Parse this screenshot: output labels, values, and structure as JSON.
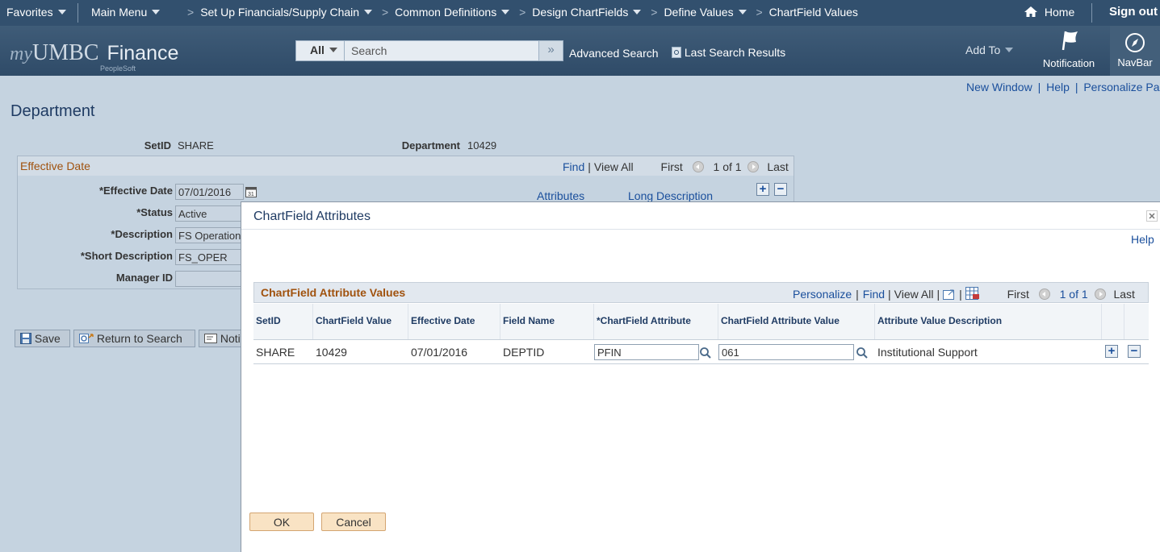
{
  "topbar": {
    "favorites": "Favorites",
    "main_menu": "Main Menu",
    "breadcrumbs": [
      "Set Up Financials/Supply Chain",
      "Common Definitions",
      "Design ChartFields",
      "Define Values",
      "ChartField Values"
    ],
    "home": "Home",
    "sign_out": "Sign out"
  },
  "header": {
    "logo_my": "my",
    "logo_umbc": "UMBC",
    "logo_finance": "Finance",
    "logo_ps": "PeopleSoft",
    "search_scope": "All",
    "search_placeholder": "Search",
    "advanced_search": "Advanced Search",
    "last_search_results": "Last Search Results",
    "add_to": "Add To",
    "notification": "Notification",
    "navbar": "NavBar"
  },
  "page": {
    "links": {
      "new_window": "New Window",
      "help": "Help",
      "personalize_page": "Personalize Page"
    },
    "title": "Department",
    "setid_label": "SetID",
    "setid_value": "SHARE",
    "department_label": "Department",
    "department_value": "10429",
    "effdt_section": "Effective Date",
    "find": "Find",
    "view_all": "View All",
    "first": "First",
    "count": "1 of 1",
    "last": "Last",
    "attributes_link": "Attributes",
    "long_desc_link": "Long Description",
    "fields": {
      "effective_date_label": "*Effective Date",
      "effective_date_value": "07/01/2016",
      "status_label": "*Status",
      "status_value": "Active",
      "description_label": "*Description",
      "description_value": "FS Operation",
      "short_desc_label": "*Short Description",
      "short_desc_value": "FS_OPER",
      "manager_label": "Manager ID",
      "manager_value": ""
    },
    "buttons": {
      "save": "Save",
      "return_to_search": "Return to Search",
      "notify": "Notif"
    }
  },
  "modal": {
    "title": "ChartField Attributes",
    "help": "Help",
    "grid": {
      "title": "ChartField Attribute Values",
      "personalize": "Personalize",
      "find": "Find",
      "view_all": "View All",
      "first": "First",
      "count": "1 of 1",
      "last": "Last",
      "columns": [
        "SetID",
        "ChartField Value",
        "Effective Date",
        "Field Name",
        "*ChartField Attribute",
        "ChartField Attribute Value",
        "Attribute Value Description"
      ],
      "row": {
        "setid": "SHARE",
        "cf_value": "10429",
        "eff_date": "07/01/2016",
        "field_name": "DEPTID",
        "cf_attribute": "PFIN",
        "cf_attr_value": "061",
        "attr_desc": "Institutional Support"
      }
    },
    "ok": "OK",
    "cancel": "Cancel"
  },
  "colors": {
    "topbar": "#32506e",
    "link": "#1a4f9c",
    "grid_title": "#a0520e",
    "page_bg": "#c5d3e0"
  }
}
